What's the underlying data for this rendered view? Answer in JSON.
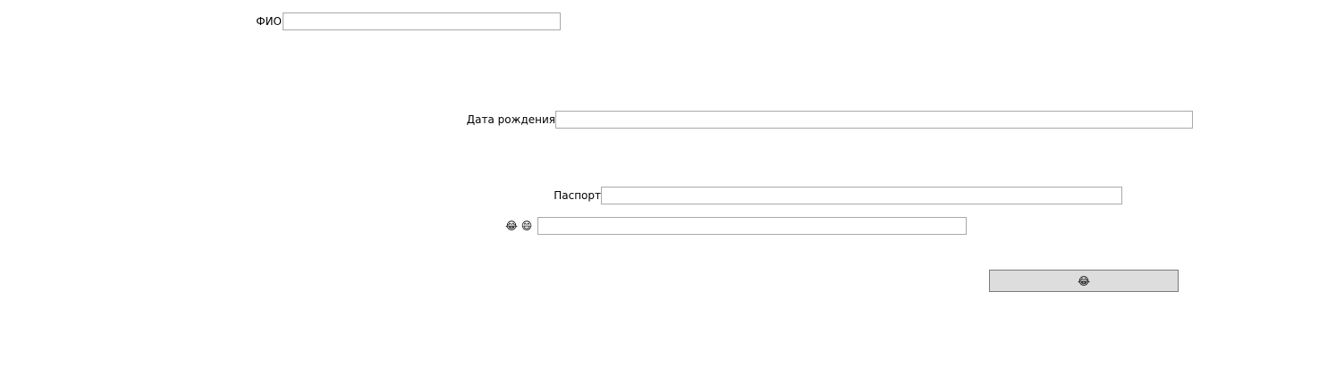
{
  "form": {
    "fio": {
      "label": "ФИО",
      "value": "",
      "placeholder": ""
    },
    "birth_date": {
      "label": "Дата рождения",
      "value": "",
      "placeholder": ""
    },
    "passport": {
      "label": "Паспорт",
      "value": "",
      "placeholder": ""
    },
    "emoji_field": {
      "icons": [
        {
          "name": "face-with-tears-of-joy-icon",
          "glyph": "😂"
        },
        {
          "name": "grinning-face-icon",
          "glyph": "😄"
        }
      ],
      "value": "",
      "placeholder": ""
    },
    "submit_button": {
      "icon_name": "face-with-tears-of-joy-icon",
      "glyph": "😂"
    }
  }
}
